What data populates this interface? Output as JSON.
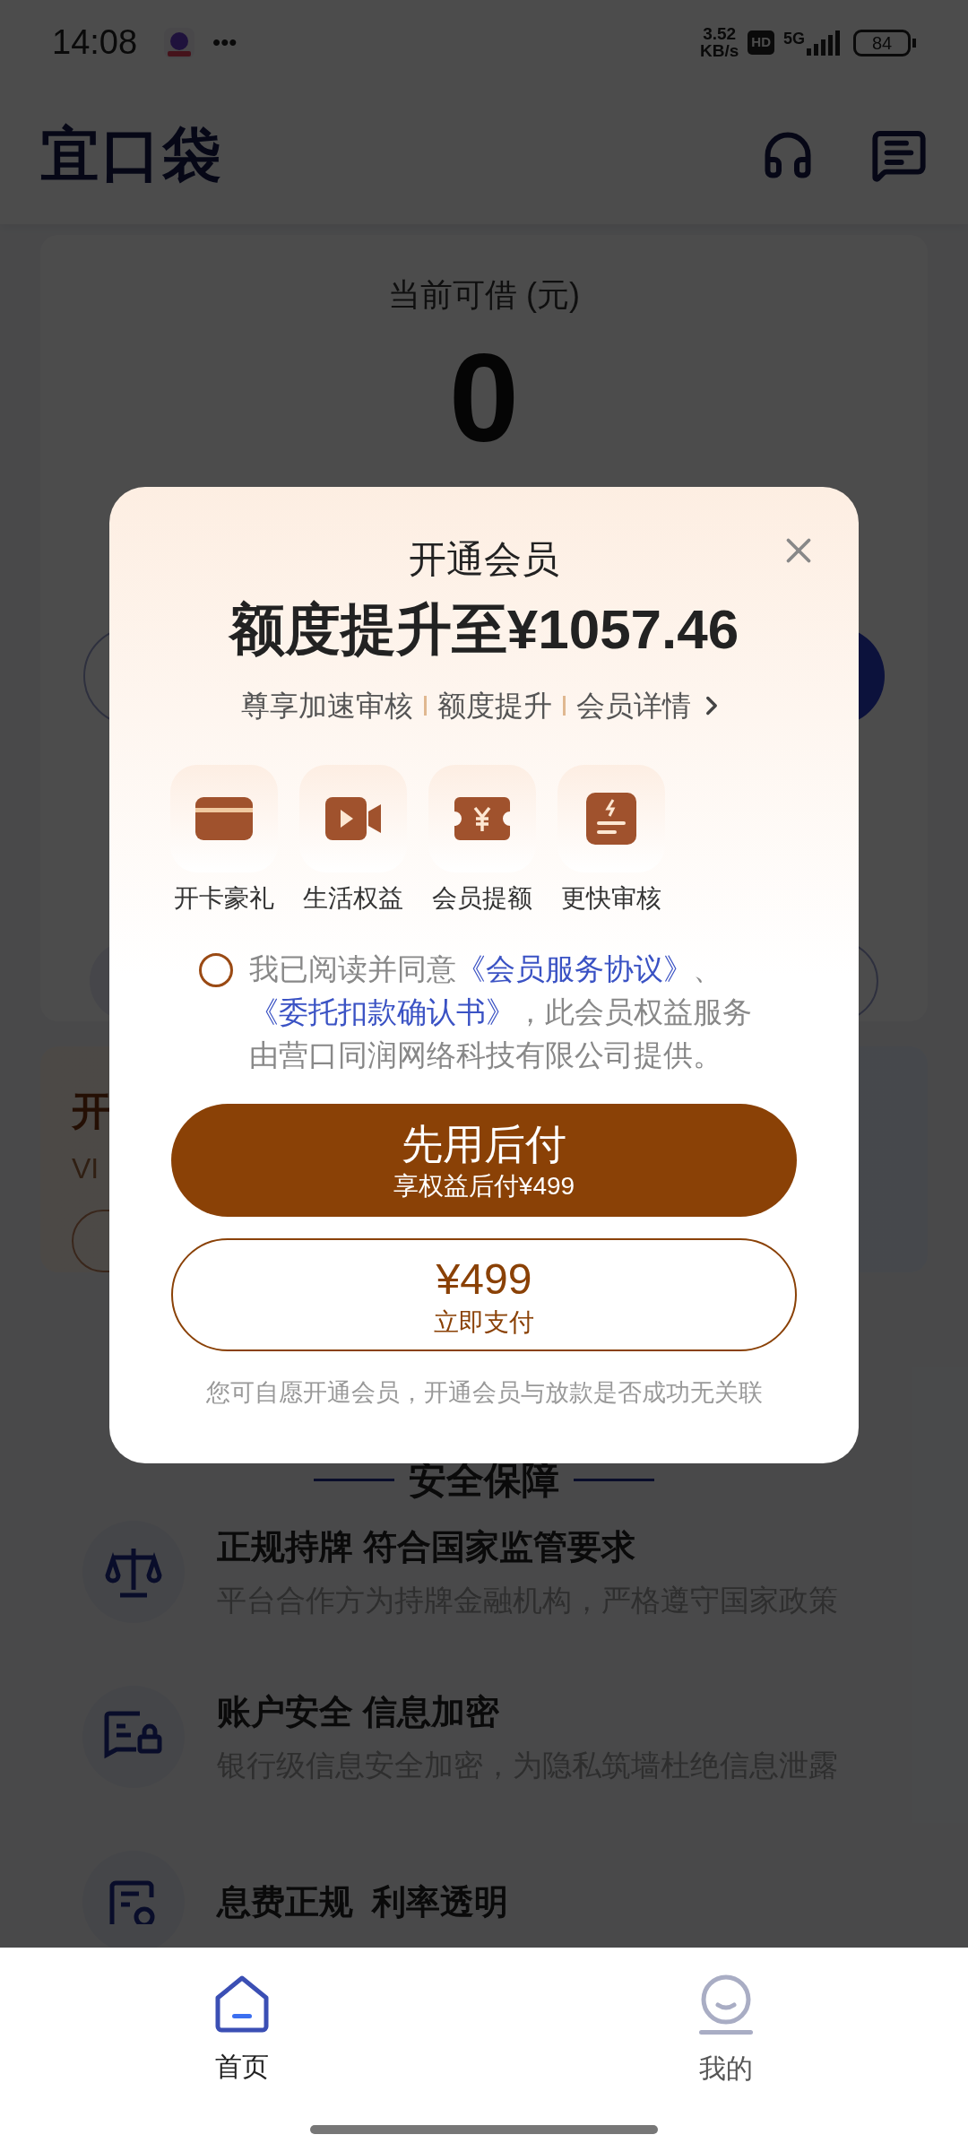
{
  "status_bar": {
    "time": "14:08",
    "more": "•••",
    "net_speed": "3.52",
    "net_unit": "KB/s",
    "hd": "HD",
    "network": "5G",
    "battery": "84"
  },
  "header": {
    "logo": "宜口袋"
  },
  "quota_card": {
    "label": "当前可借 (元)",
    "amount": "0"
  },
  "vip_card": {
    "title": "开",
    "subtitle": "VI"
  },
  "security": {
    "title": "安全保障",
    "items": [
      {
        "kind": "license",
        "title": "正规持牌 符合国家监管要求",
        "subtitle": "平台合作方为持牌金融机构，严格遵守国家政策"
      },
      {
        "kind": "lock",
        "title": "账户安全 信息加密",
        "subtitle": "银行级信息安全加密，为隐私筑墙杜绝信息泄露"
      },
      {
        "kind": "document",
        "title": "息费正规  利率透明"
      }
    ]
  },
  "modal": {
    "title": "开通会员",
    "headline": "额度提升至¥1057.46",
    "perks": [
      "尊享加速审核",
      "额度提升"
    ],
    "details_link": "会员详情",
    "benefits": [
      {
        "kind": "card",
        "label": "开卡豪礼"
      },
      {
        "kind": "video",
        "label": "生活权益"
      },
      {
        "kind": "ticket",
        "label": "会员提额"
      },
      {
        "kind": "document",
        "label": "更快审核"
      }
    ],
    "agreement": {
      "checked": false,
      "text_before": "我已阅读并同意",
      "link_1": "《会员服务协议》",
      "separator": "、",
      "link_2": "《委托扣款确认书》",
      "text_after": "，此会员权益服务由营口同润网络科技有限公司提供。"
    },
    "primary_button": {
      "title": "先用后付",
      "subtitle": "享权益后付¥499"
    },
    "secondary_button": {
      "title": "¥499",
      "subtitle": "立即支付"
    },
    "note": "您可自愿开通会员，开通会员与放款是否成功无关联"
  },
  "tab_bar": [
    {
      "kind": "home",
      "label": "首页",
      "selected": true
    },
    {
      "kind": "profile",
      "label": "我的",
      "selected": false
    }
  ]
}
